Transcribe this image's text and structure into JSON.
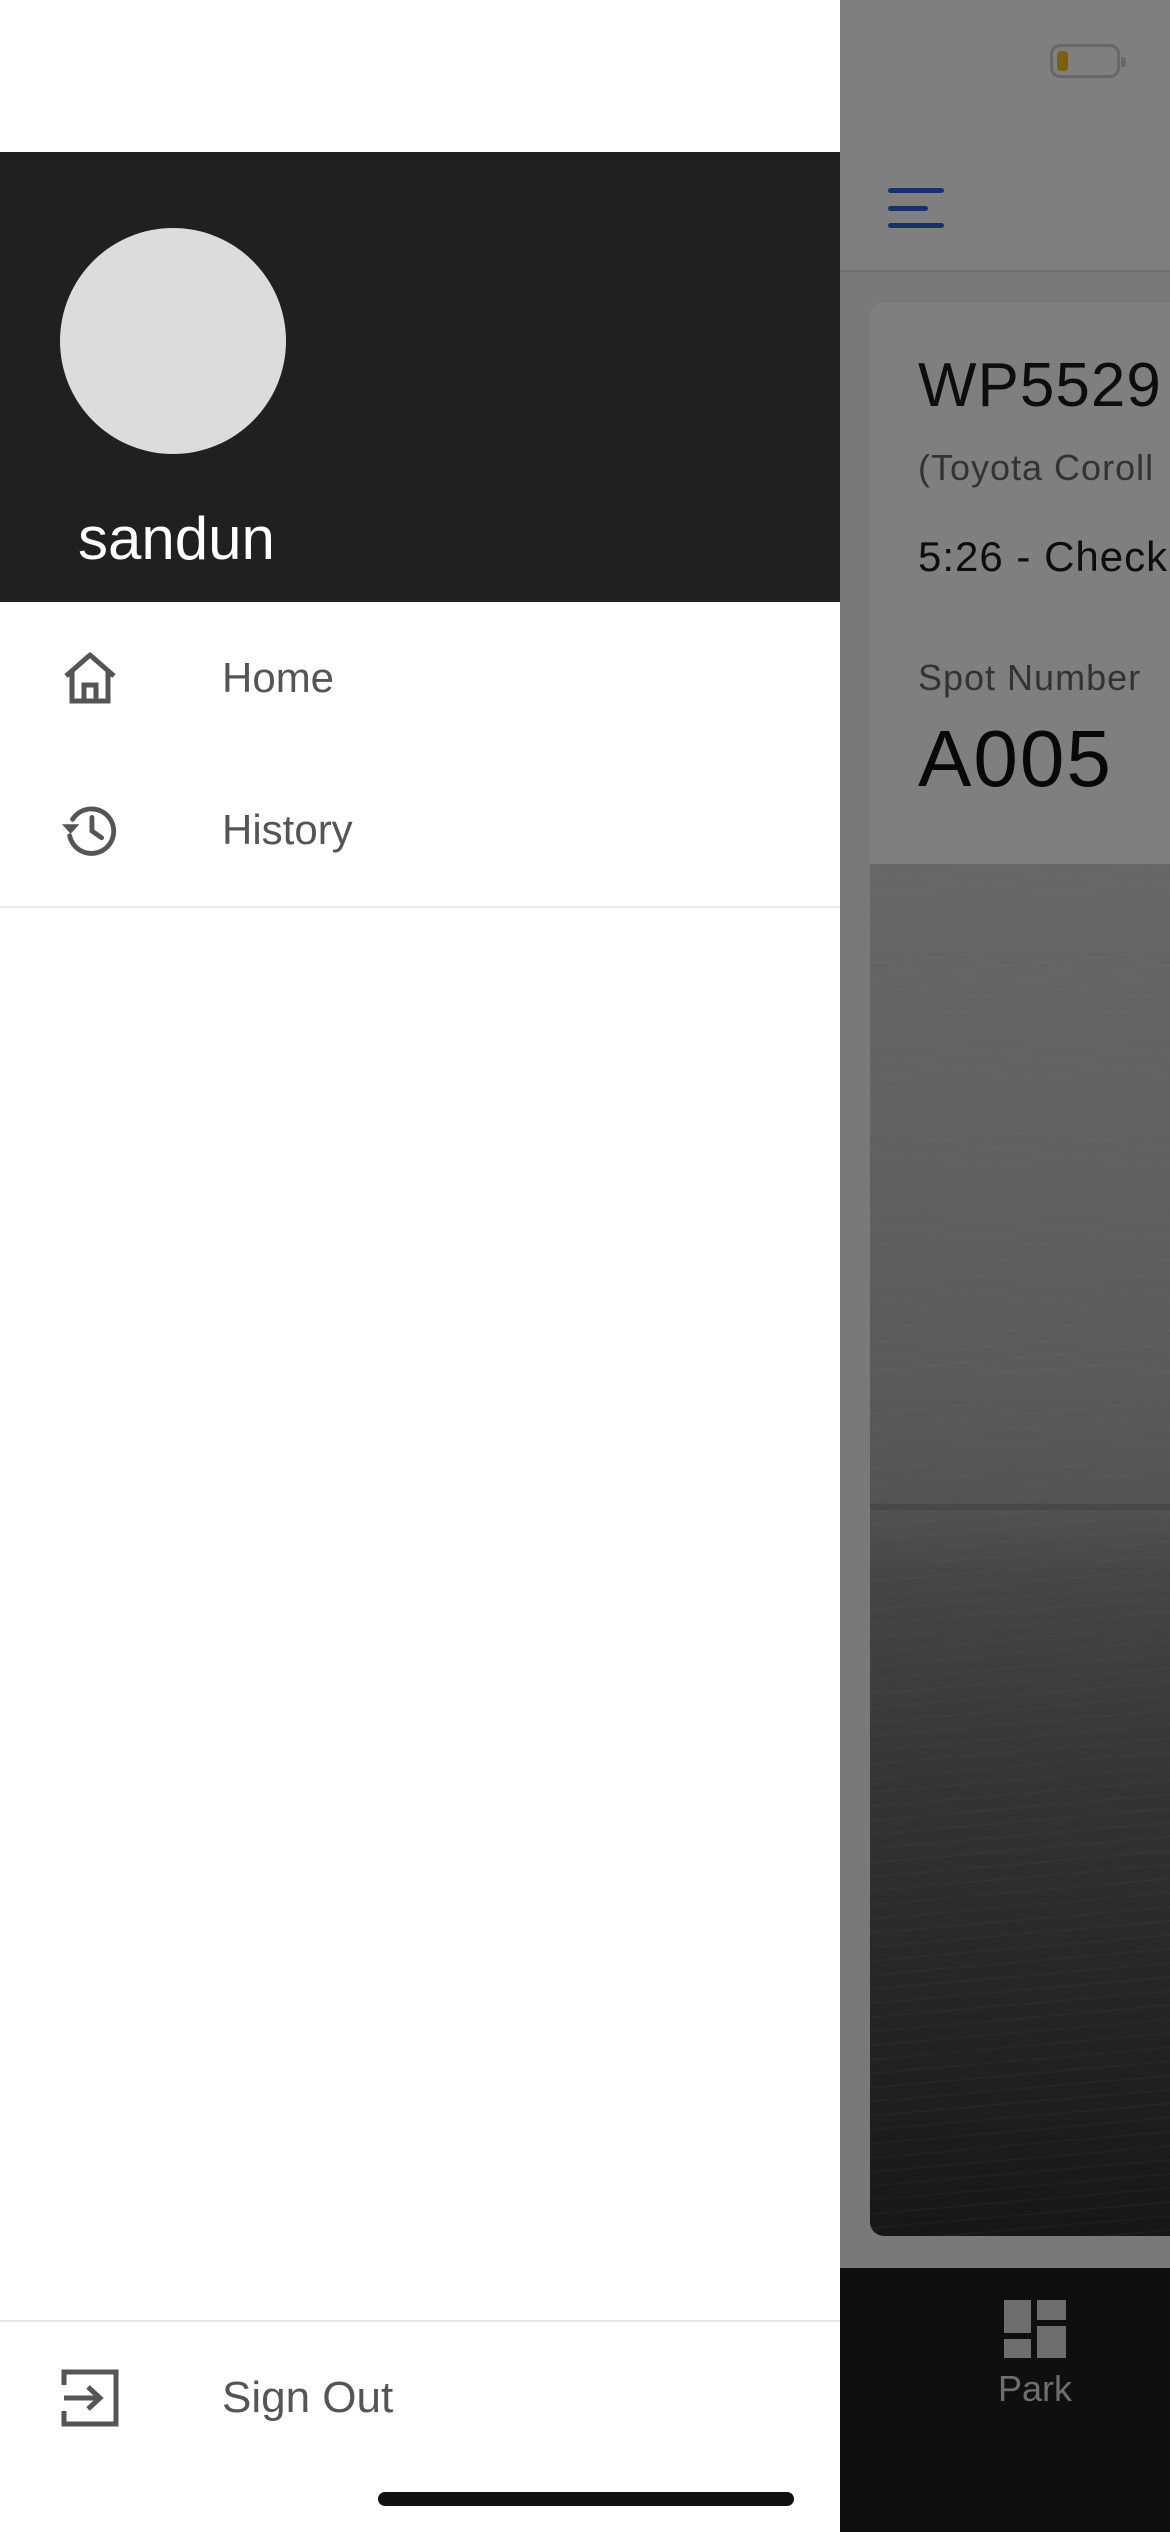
{
  "user": {
    "name": "sandun"
  },
  "drawer": {
    "items": [
      {
        "label": "Home",
        "icon": "home-icon"
      },
      {
        "label": "History",
        "icon": "history-icon"
      }
    ],
    "signout": {
      "label": "Sign Out",
      "icon": "sign-out-icon"
    }
  },
  "parking": {
    "plate": "WP5529",
    "vehicle": "(Toyota Coroll",
    "checkin": "5:26 - Check",
    "spot_label": "Spot Number",
    "spot_value": "A005"
  },
  "bottom_nav": {
    "park_label": "Park",
    "park_icon": "dashboard-icon"
  },
  "status_bar": {
    "battery_level": 0.2,
    "battery_color": "#f5c518"
  },
  "colors": {
    "accent": "#2e63d6",
    "drawer_header": "#202020"
  }
}
